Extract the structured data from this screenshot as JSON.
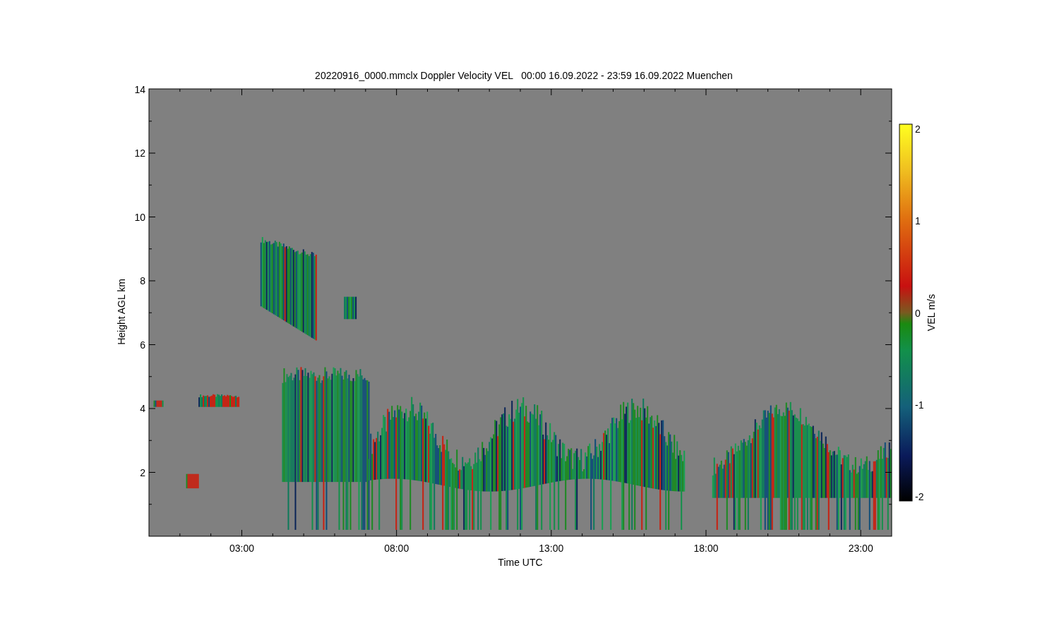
{
  "chart": {
    "title": "20220916_0000.mmclx Doppler Velocity VEL   00:00 16.09.2022 - 23:59 16.09.2022 Muenchen",
    "xlabel": "Time UTC",
    "ylabel": "Height AGL km",
    "xticks": [
      "03:00",
      "08:00",
      "13:00",
      "18:00",
      "23:00"
    ],
    "yticks": [
      "14",
      "12",
      "10",
      "8",
      "6",
      "4",
      "2"
    ]
  },
  "colorbar": {
    "label": "VEL m/s",
    "ticks": [
      "2",
      "1",
      "0",
      "-1",
      "-2"
    ]
  }
}
